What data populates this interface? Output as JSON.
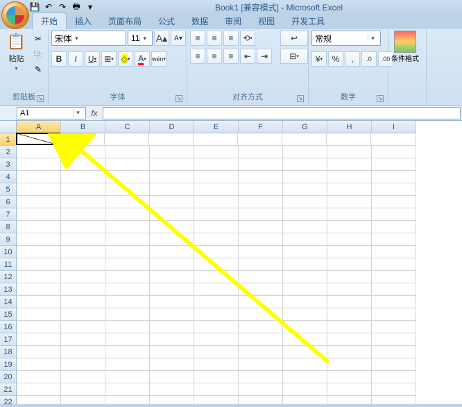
{
  "title": "Book1 [兼容模式] - Microsoft Excel",
  "qat": {
    "save": "💾",
    "undo": "↶",
    "redo": "↷",
    "print": "🖶"
  },
  "tabs": [
    "开始",
    "插入",
    "页面布局",
    "公式",
    "数据",
    "审阅",
    "视图",
    "开发工具"
  ],
  "active_tab": 0,
  "ribbon": {
    "clipboard": {
      "title": "剪贴板",
      "paste": "粘贴",
      "cut": "✂",
      "copy": "⿻",
      "brush": "✎"
    },
    "font": {
      "title": "字体",
      "name": "宋体",
      "size": "11",
      "grow": "A",
      "shrink": "A",
      "bold": "B",
      "italic": "I",
      "underline": "U",
      "border": "⊞",
      "fill": "◇",
      "color": "A",
      "phonetic": "wén"
    },
    "align": {
      "title": "对齐方式",
      "top": "≡",
      "middle": "≡",
      "bottom": "≡",
      "orient": "⟲",
      "wrap": "↩",
      "left": "≡",
      "center": "≡",
      "right": "≡",
      "dedent": "⇤",
      "indent": "⇥",
      "merge": "⊟"
    },
    "number": {
      "title": "数字",
      "format": "常规",
      "currency": "¥",
      "percent": "%",
      "comma": ",",
      "inc": ".0",
      "dec": ".00"
    },
    "styles": {
      "title": "",
      "cond": "条件格式"
    }
  },
  "namebox": "A1",
  "fx": "fx",
  "columns": [
    "A",
    "B",
    "C",
    "D",
    "E",
    "F",
    "G",
    "H",
    "I"
  ],
  "rows": [
    "1",
    "2",
    "3",
    "4",
    "5",
    "6",
    "7",
    "8",
    "9",
    "10",
    "11",
    "12",
    "13",
    "14",
    "15",
    "16",
    "17",
    "18",
    "19",
    "20",
    "21",
    "22"
  ],
  "active_cell": {
    "row": 0,
    "col": 0
  }
}
